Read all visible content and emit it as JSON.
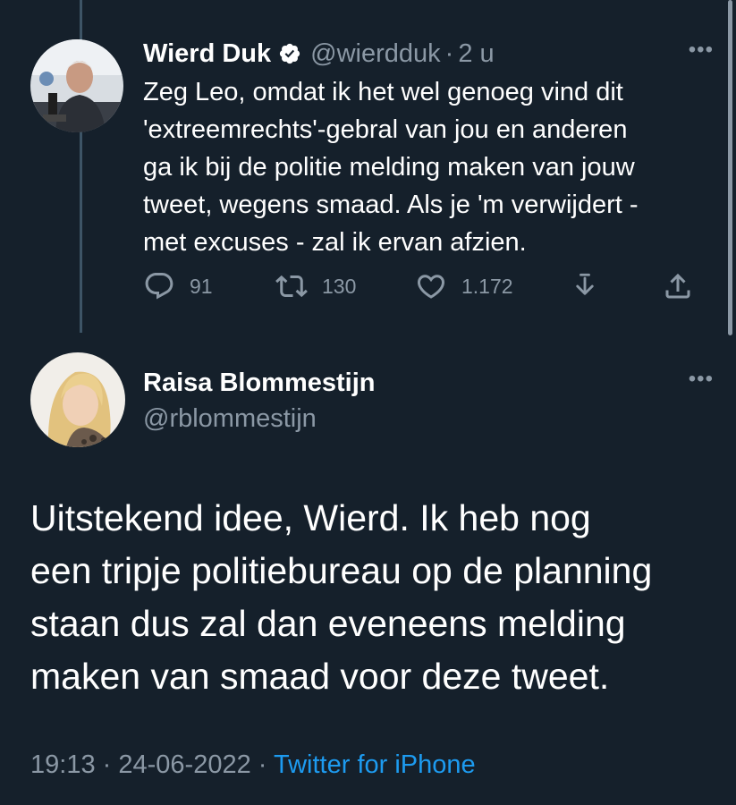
{
  "colors": {
    "background": "#15202b",
    "text_primary": "#ffffff",
    "text_muted": "#8b98a5",
    "link": "#1d9bf0",
    "thread_line": "#3d5466"
  },
  "tweet_parent": {
    "display_name": "Wierd Duk",
    "verified_icon": "verified-badge-icon",
    "handle": "@wierdduk",
    "separator": "·",
    "time_ago": "2 u",
    "more_icon": "•••",
    "text_lines": [
      "Zeg Leo, omdat ik het wel genoeg vind dit",
      "'extreemrechts'-gebral van jou en anderen",
      "ga ik bij de politie melding maken van jouw",
      "tweet, wegens smaad. Als je 'm verwijdert -",
      "met excuses - zal ik ervan afzien."
    ],
    "actions": {
      "reply_count": "91",
      "retweet_count": "130",
      "like_count": "1.172"
    }
  },
  "tweet_main": {
    "display_name": "Raisa Blommestijn",
    "handle": "@rblommestijn",
    "more_icon": "•••",
    "text_lines": [
      "Uitstekend idee, Wierd. Ik heb nog",
      "een tripje politiebureau op de planning",
      "staan dus zal dan eveneens melding",
      "maken van smaad voor deze tweet."
    ],
    "time": "19:13",
    "date": "24-06-2022",
    "separator": "·",
    "source": "Twitter for iPhone"
  }
}
